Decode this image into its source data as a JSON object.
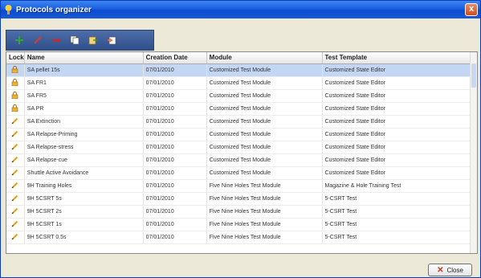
{
  "window": {
    "title": "Protocols organizer",
    "close_glyph": "x"
  },
  "toolbar": {
    "buttons": [
      {
        "name": "add-protocol-button",
        "icon": "plus-icon",
        "color": "#2eaa2e"
      },
      {
        "name": "edit-protocol-button",
        "icon": "pencil-icon",
        "color": "#d63a2a"
      },
      {
        "name": "delete-protocol-button",
        "icon": "minus-icon",
        "color": "#e02020"
      },
      {
        "name": "copy-protocol-button",
        "icon": "copy-icon",
        "color": "#ffffff"
      },
      {
        "name": "export-protocol-button",
        "icon": "export-icon",
        "color": "#f0c040"
      },
      {
        "name": "import-protocol-button",
        "icon": "import-icon",
        "color": "#ff6a3a"
      }
    ]
  },
  "table": {
    "columns": [
      "Lock",
      "Name",
      "Creation Date",
      "Module",
      "Test Template"
    ],
    "rows": [
      {
        "lock": "lock-icon",
        "name": "SA pellet 15s",
        "date": "07/01/2010",
        "module": "Customized Test Module",
        "template": "Customized State Editor",
        "selected": true
      },
      {
        "lock": "lock-icon",
        "name": "SA FR1",
        "date": "07/01/2010",
        "module": "Customized Test Module",
        "template": "Customized State Editor"
      },
      {
        "lock": "lock-icon",
        "name": "SA FR5",
        "date": "07/01/2010",
        "module": "Customized Test Module",
        "template": "Customized State Editor"
      },
      {
        "lock": "lock-icon",
        "name": "SA PR",
        "date": "07/01/2010",
        "module": "Customized Test Module",
        "template": "Customized State Editor"
      },
      {
        "lock": "pencil-icon",
        "name": "SA Extinction",
        "date": "07/01/2010",
        "module": "Customized Test Module",
        "template": "Customized State Editor"
      },
      {
        "lock": "pencil-icon",
        "name": "SA Relapse-Priming",
        "date": "07/01/2010",
        "module": "Customized Test Module",
        "template": "Customized State Editor"
      },
      {
        "lock": "pencil-icon",
        "name": "SA Relapse-stress",
        "date": "07/01/2010",
        "module": "Customized Test Module",
        "template": "Customized State Editor"
      },
      {
        "lock": "pencil-icon",
        "name": "SA Relapse-cue",
        "date": "07/01/2010",
        "module": "Customized Test Module",
        "template": "Customized State Editor"
      },
      {
        "lock": "pencil-icon",
        "name": "Shuttle Active Avoidance",
        "date": "07/01/2010",
        "module": "Customized Test Module",
        "template": "Customized State Editor"
      },
      {
        "lock": "pencil-icon",
        "name": "9H Training Holes",
        "date": "07/01/2010",
        "module": "Five Nine Holes Test Module",
        "template": "Magazine & Hole Training Test"
      },
      {
        "lock": "pencil-icon",
        "name": "9H 5CSRT 5s",
        "date": "07/01/2010",
        "module": "Five Nine Holes Test Module",
        "template": "5-CSRT Test"
      },
      {
        "lock": "pencil-icon",
        "name": "9H 5CSRT 2s",
        "date": "07/01/2010",
        "module": "Five Nine Holes Test Module",
        "template": "5-CSRT Test"
      },
      {
        "lock": "pencil-icon",
        "name": "9H 5CSRT 1s",
        "date": "07/01/2010",
        "module": "Five Nine Holes Test Module",
        "template": "5-CSRT Test"
      },
      {
        "lock": "pencil-icon",
        "name": "9H 5CSRT 0.5s",
        "date": "07/01/2010",
        "module": "Five Nine Holes Test Module",
        "template": "5-CSRT Test"
      }
    ]
  },
  "footer": {
    "close_label": "Close"
  }
}
